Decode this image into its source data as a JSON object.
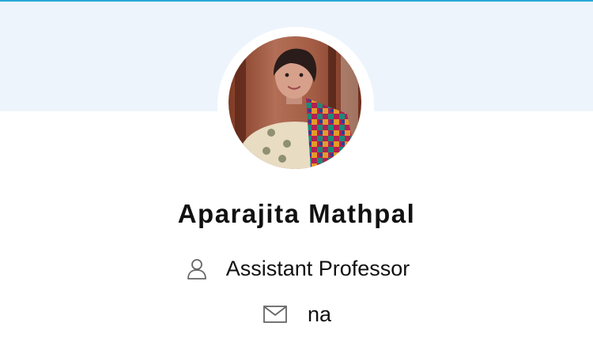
{
  "profile": {
    "name": "Aparajita Mathpal",
    "designation": "Assistant Professor",
    "email": "na"
  },
  "icons": {
    "designation": "user-icon",
    "email": "mail-icon"
  },
  "colors": {
    "accent_top_border": "#29a8d8",
    "banner_background": "#eef4fc",
    "text": "#111111",
    "icon": "#666666"
  }
}
